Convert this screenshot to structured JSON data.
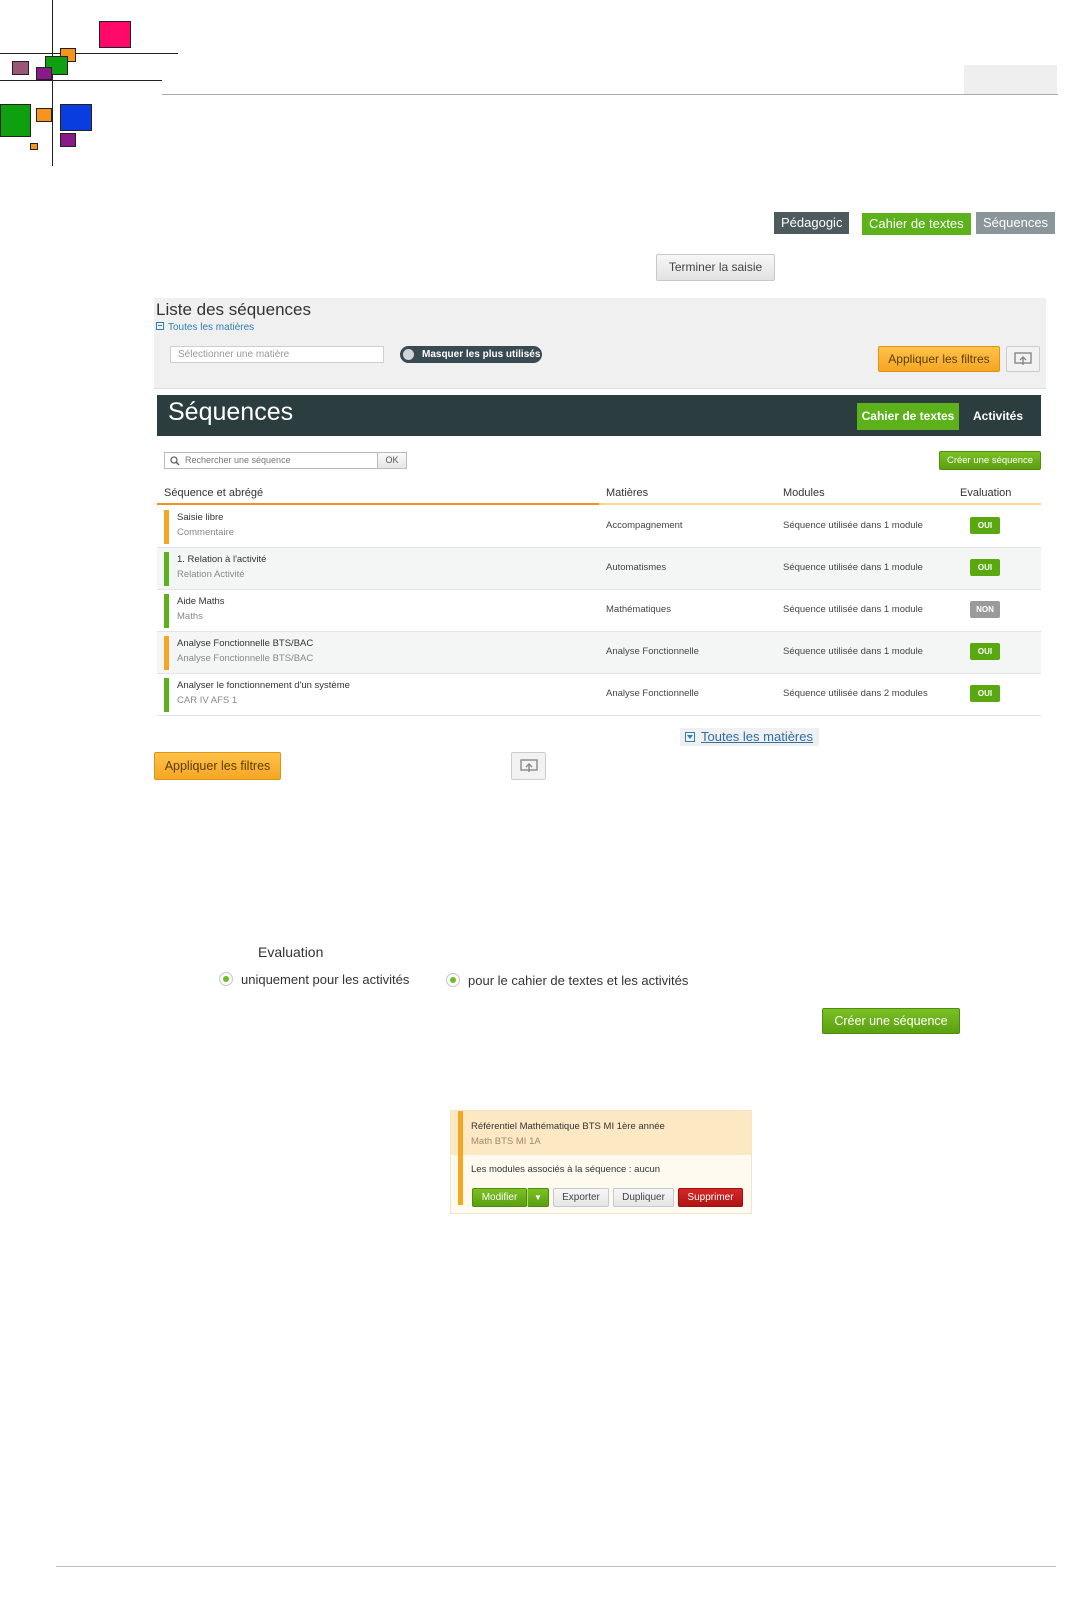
{
  "top_tags": {
    "pedagogic": "Pédagogic",
    "cahier": "Cahier de textes",
    "sequences": "Séquences"
  },
  "terminer_label": "Terminer la saisie",
  "filter_panel": {
    "title": "Liste des séquences",
    "toggle_all": "Toutes les matières",
    "matiere_placeholder": "Sélectionner une matière",
    "switch_label": "Masquer les plus utilisés",
    "apply_label": "Appliquer les filtres"
  },
  "sequences_panel": {
    "title": "Séquences",
    "tab_active": "Cahier de textes",
    "tab_other": "Activités",
    "search_placeholder": "Rechercher une séquence",
    "ok_label": "OK",
    "create_label": "Créer une séquence"
  },
  "table": {
    "headers": [
      "Séquence et abrégé",
      "Matières",
      "Modules",
      "Evaluation"
    ],
    "rows": [
      {
        "name": "Saisie libre",
        "short": "Commentaire",
        "matiere": "Accompagnement",
        "modules": "Séquence utilisée dans 1 module",
        "evaluation": "OUI",
        "bar_color": "#f5a623",
        "badge_color": "#5aa80f"
      },
      {
        "name": "1. Relation à l'activité",
        "short": "Relation Activité",
        "matiere": "Automatismes",
        "modules": "Séquence utilisée dans 1 module",
        "evaluation": "OUI",
        "bar_color": "#5db11b",
        "badge_color": "#5aa80f"
      },
      {
        "name": "Aide Maths",
        "short": "Maths",
        "matiere": "Mathématiques",
        "modules": "Séquence utilisée dans 1 module",
        "evaluation": "NON",
        "bar_color": "#5db11b",
        "badge_color": "#9a9a9a"
      },
      {
        "name": "Analyse Fonctionnelle BTS/BAC",
        "short": "Analyse Fonctionnelle BTS/BAC",
        "matiere": "Analyse Fonctionnelle",
        "modules": "Séquence utilisée dans 1 module",
        "evaluation": "OUI",
        "bar_color": "#f5a623",
        "badge_color": "#5aa80f"
      },
      {
        "name": "Analyser le fonctionnement d'un système",
        "short": "CAR IV AFS 1",
        "matiere": "Analyse Fonctionnelle",
        "modules": "Séquence utilisée dans 2 modules",
        "evaluation": "OUI",
        "bar_color": "#5db11b",
        "badge_color": "#5aa80f"
      }
    ]
  },
  "toutes_link": "Toutes les matières",
  "apply_bottom_label": "Appliquer les filtres",
  "evaluation": {
    "title": "Evaluation",
    "option1": "uniquement pour les activités",
    "option2": "pour le cahier de textes et les activités",
    "create_label": "Créer une séquence"
  },
  "detail": {
    "title": "Référentiel Mathématique BTS MI 1ère année",
    "short": "Math BTS MI 1A",
    "modules_text": "Les modules associés à la séquence : aucun",
    "btn_modifier": "Modifier",
    "btn_arrow": "▼",
    "btn_exporter": "Exporter",
    "btn_dupliquer": "Dupliquer",
    "btn_supprimer": "Supprimer"
  },
  "colors": {
    "accent_green": "#5db11b",
    "accent_orange": "#f5a623",
    "header_dark": "#2b3d3f",
    "danger_red": "#c21a1a"
  }
}
